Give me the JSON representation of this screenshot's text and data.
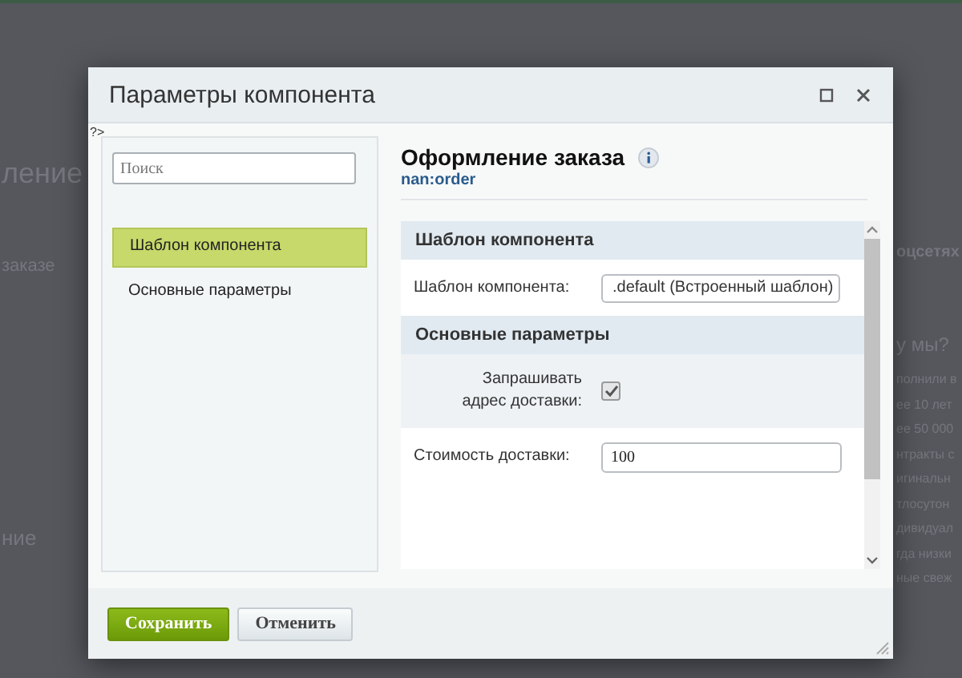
{
  "background_page": {
    "left_texts": [
      {
        "text": "ление",
        "kind": "heading"
      },
      {
        "text": "заказе",
        "kind": "line"
      },
      {
        "text": "ние",
        "kind": "subheading"
      }
    ],
    "right_texts": [
      {
        "text": "оцсетях",
        "kind": "heading"
      },
      {
        "text": "у мы?",
        "kind": "subheading"
      },
      {
        "text": "полнили в",
        "kind": "line"
      },
      {
        "text": "ее 10 лет",
        "kind": "line"
      },
      {
        "text": "ее 50 000",
        "kind": "line"
      },
      {
        "text": "нтракты с",
        "kind": "line"
      },
      {
        "text": "игинальн",
        "kind": "line"
      },
      {
        "text": "тлосутон",
        "kind": "line"
      },
      {
        "text": "дивидуал",
        "kind": "line"
      },
      {
        "text": "гда низки",
        "kind": "line"
      },
      {
        "text": "ные свеж",
        "kind": "line"
      }
    ]
  },
  "dialog": {
    "title": "Параметры компонента",
    "stray_text": "?>",
    "sidebar": {
      "search": {
        "placeholder": "Поиск"
      },
      "items": [
        {
          "label": "Шаблон компонента",
          "selected": true
        },
        {
          "label": "Основные параметры",
          "selected": false
        }
      ]
    },
    "component": {
      "name": "Оформление заказа",
      "code": "nan:order"
    },
    "sections": [
      {
        "title": "Шаблон компонента",
        "fields": [
          {
            "kind": "select",
            "label": "Шаблон компонента:",
            "value": ".default (Встроенный шаблон)"
          }
        ]
      },
      {
        "title": "Основные параметры",
        "fields": [
          {
            "kind": "checkbox",
            "label": "Запрашивать адрес доставки:",
            "checked": true
          },
          {
            "kind": "text",
            "label": "Стоимость доставки:",
            "value": "100"
          }
        ]
      }
    ],
    "buttons": [
      {
        "label": "Сохранить",
        "kind": "primary"
      },
      {
        "label": "Отменить",
        "kind": "secondary"
      }
    ]
  }
}
